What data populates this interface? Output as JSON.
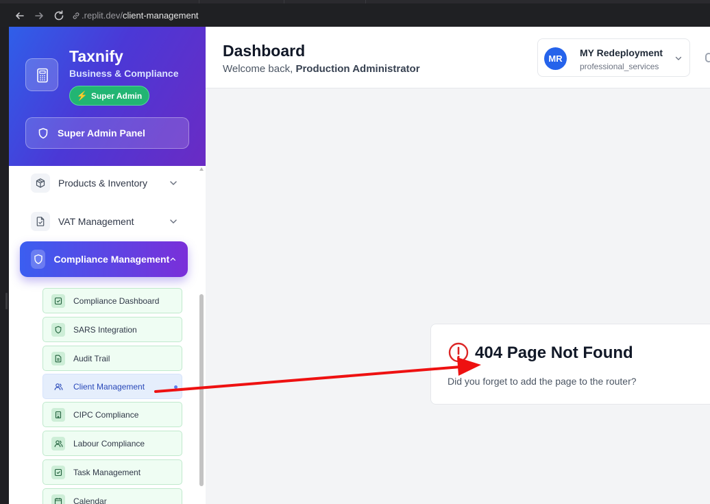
{
  "browser": {
    "url_prefix": ".replit.dev/",
    "url_path": "client-management",
    "icons": [
      "back-arrow-icon",
      "forward-arrow-icon",
      "reload-icon",
      "site-info-icon"
    ]
  },
  "sidebar": {
    "app_name": "Taxnify",
    "app_subtitle": "Business & Compliance",
    "badge": "Super Admin",
    "panel_button": "Super Admin Panel",
    "items": [
      {
        "label": "Products & Inventory",
        "icon": "box-icon",
        "expanded": false
      },
      {
        "label": "VAT Management",
        "icon": "file-check-icon",
        "expanded": false
      },
      {
        "label": "Compliance Management",
        "icon": "shield-icon",
        "expanded": true
      }
    ],
    "sub_items": [
      {
        "label": "Compliance Dashboard",
        "icon": "checkbox-icon"
      },
      {
        "label": "SARS Integration",
        "icon": "shield-icon"
      },
      {
        "label": "Audit Trail",
        "icon": "document-icon"
      },
      {
        "label": "Client Management",
        "icon": "users-icon",
        "selected": true
      },
      {
        "label": "CIPC Compliance",
        "icon": "building-icon"
      },
      {
        "label": "Labour Compliance",
        "icon": "users-icon"
      },
      {
        "label": "Task Management",
        "icon": "checkbox-icon"
      },
      {
        "label": "Calendar",
        "icon": "calendar-icon"
      }
    ]
  },
  "header": {
    "title": "Dashboard",
    "welcome_prefix": "Welcome back,",
    "user_name": "Production Administrator",
    "company": {
      "initials": "MR",
      "name": "MY Redeployment",
      "type": "professional_services"
    }
  },
  "error": {
    "title": "404 Page Not Found",
    "message": "Did you forget to add the page to the router?"
  },
  "colors": {
    "sidebar_gradient_start": "#2f5fe9",
    "sidebar_gradient_end": "#6a2bc4",
    "badge_green": "#22b573",
    "error_red": "#dc2626",
    "annotation_arrow": "#ee1111",
    "avatar_blue": "#2563eb"
  }
}
